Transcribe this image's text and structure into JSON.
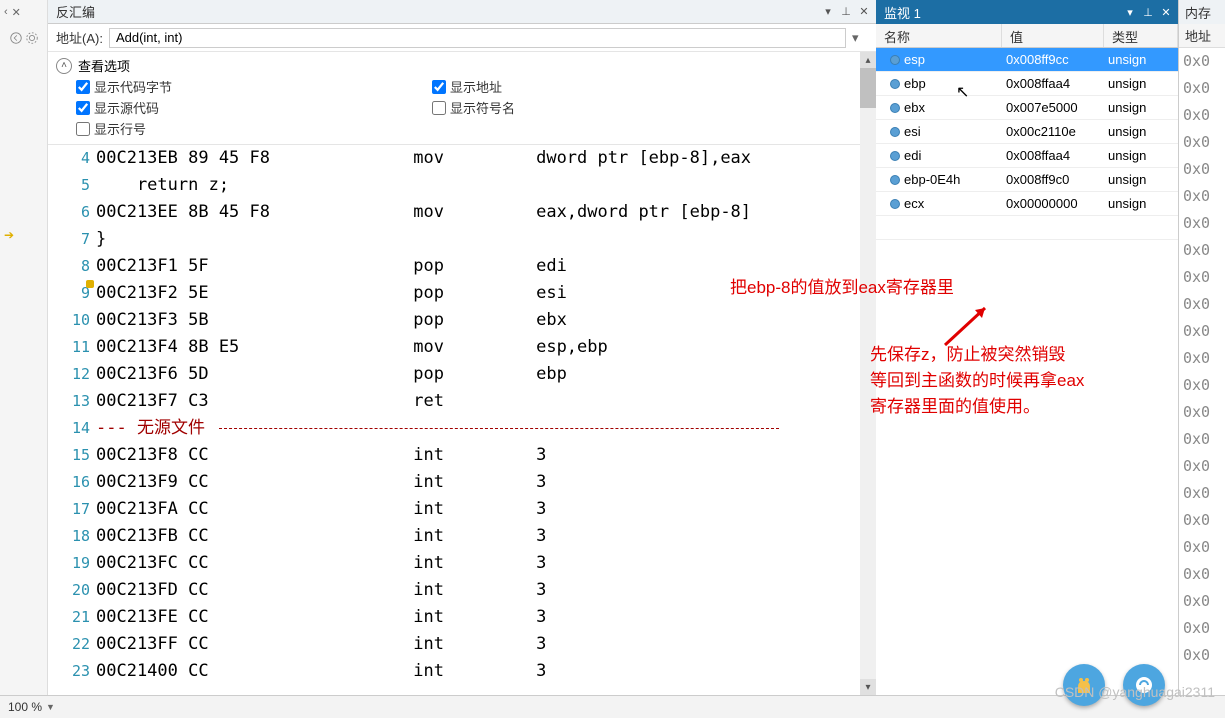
{
  "left_gutter": {
    "close_symbols": "✕"
  },
  "disasm": {
    "title": "反汇编",
    "pin_title": "Pin",
    "close_title": "Close",
    "address_label": "地址(A):",
    "address_value": "Add(int, int)",
    "options_title": "查看选项",
    "opt_show_code_bytes": "显示代码字节",
    "opt_show_source": "显示源代码",
    "opt_show_linenum": "显示行号",
    "opt_show_address": "显示地址",
    "opt_show_symbol": "显示符号名",
    "line_start": 4,
    "line_end": 23,
    "lines": [
      {
        "text": "00C213EB 89 45 F8              mov         dword ptr [ebp-8],eax"
      },
      {
        "text": "    return z;"
      },
      {
        "text": "00C213EE 8B 45 F8              mov         eax,dword ptr [ebp-8]"
      },
      {
        "text": "}"
      },
      {
        "text": "00C213F1 5F                    pop         edi",
        "marker": "yellow"
      },
      {
        "text": "00C213F2 5E                    pop         esi"
      },
      {
        "text": "00C213F3 5B                    pop         ebx"
      },
      {
        "text": "00C213F4 8B E5                 mov         esp,ebp"
      },
      {
        "text": "00C213F6 5D                    pop         ebp"
      },
      {
        "text": "00C213F7 C3                    ret"
      },
      {
        "text": "--- 无源文件 ",
        "sep": true
      },
      {
        "text": "00C213F8 CC                    int         3"
      },
      {
        "text": "00C213F9 CC                    int         3"
      },
      {
        "text": "00C213FA CC                    int         3"
      },
      {
        "text": "00C213FB CC                    int         3"
      },
      {
        "text": "00C213FC CC                    int         3"
      },
      {
        "text": "00C213FD CC                    int         3"
      },
      {
        "text": "00C213FE CC                    int         3"
      },
      {
        "text": "00C213FF CC                    int         3"
      },
      {
        "text": "00C21400 CC                    int         3"
      }
    ]
  },
  "watch": {
    "title": "监视 1",
    "col_name": "名称",
    "col_value": "值",
    "col_type": "类型",
    "rows": [
      {
        "name": "esp",
        "value": "0x008ff9cc",
        "type": "unsign",
        "selected": true
      },
      {
        "name": "ebp",
        "value": "0x008ffaa4",
        "type": "unsign"
      },
      {
        "name": "ebx",
        "value": "0x007e5000",
        "type": "unsign"
      },
      {
        "name": "esi",
        "value": "0x00c2110e",
        "type": "unsign"
      },
      {
        "name": "edi",
        "value": "0x008ffaa4",
        "type": "unsign"
      },
      {
        "name": "ebp-0E4h",
        "value": "0x008ff9c0",
        "type": "unsign"
      },
      {
        "name": "ecx",
        "value": "0x00000000",
        "type": "unsign"
      }
    ]
  },
  "memory": {
    "title": "内存",
    "addr_label": "地址",
    "value": "0x0"
  },
  "annotations": {
    "a1": "把ebp-8的值放到eax寄存器里",
    "a2_l1": "先保存z，防止被突然销毁",
    "a2_l2": "等回到主函数的时候再拿eax",
    "a2_l3": "寄存器里面的值使用。"
  },
  "status": {
    "zoom": "100 %"
  },
  "watermark": "CSDN @yanghuagai2311"
}
